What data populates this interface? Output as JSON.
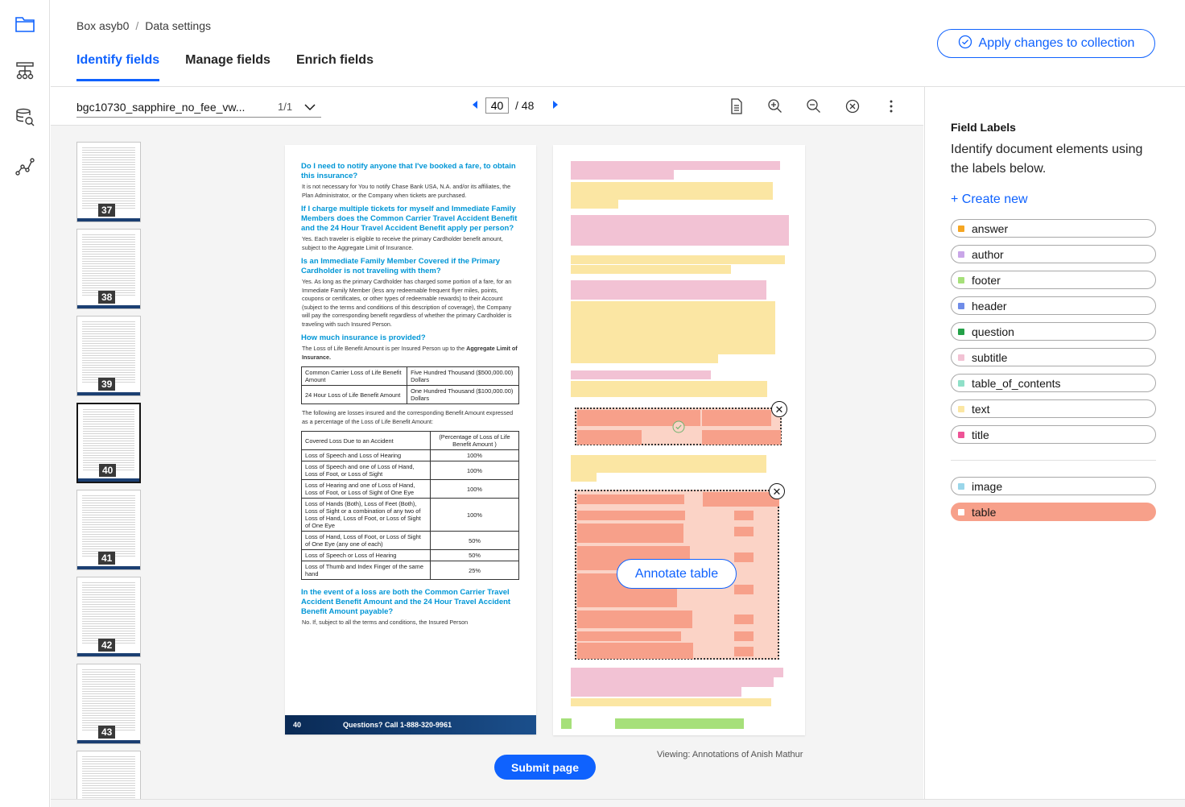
{
  "header": {
    "breadcrumb": [
      "Box asyb0",
      "Data settings"
    ],
    "tabs": [
      {
        "label": "Identify fields",
        "active": true
      },
      {
        "label": "Manage fields",
        "active": false
      },
      {
        "label": "Enrich fields",
        "active": false
      }
    ],
    "apply_label": "Apply changes to collection"
  },
  "toolbar": {
    "file_name": "bgc10730_sapphire_no_fee_vw...",
    "file_count": "1/1",
    "page_value": "40",
    "page_total": "/ 48"
  },
  "thumbnails": [
    "37",
    "38",
    "39",
    "40",
    "41",
    "42",
    "43"
  ],
  "selected_thumbnail": "40",
  "document": {
    "sections": [
      {
        "q": "Do I need to notify anyone that I've booked a fare, to obtain this insurance?",
        "a": "It is not necessary for You to notify Chase Bank USA, N.A. and/or its affiliates, the Plan Administrator, or the Company when tickets are purchased."
      },
      {
        "q": "If I charge multiple tickets for myself and Immediate Family Members does the Common Carrier Travel Accident Benefit and the 24 Hour Travel Accident Benefit apply per person?",
        "a": "Yes. Each traveler is eligible to receive the primary Cardholder benefit amount, subject to the Aggregate Limit of Insurance."
      },
      {
        "q": "Is an Immediate Family Member Covered if the Primary Cardholder is not traveling with them?",
        "a": "Yes. As long as the primary Cardholder has charged some portion of a fare, for an Immediate Family Member (less any redeemable frequent flyer miles, points, coupons or certificates, or other types of redeemable rewards) to their Account (subject to the terms and conditions of this description of coverage), the Company will pay the corresponding benefit regardless of whether the primary Cardholder is traveling with such Insured Person."
      },
      {
        "q": "How much insurance is provided?",
        "a": "The Loss of Life Benefit Amount is per Insured Person up to the",
        "a_bold": "Aggregate Limit of Insurance."
      }
    ],
    "table1": [
      [
        "Common Carrier Loss of Life Benefit Amount",
        "Five Hundred Thousand ($500,000.00) Dollars"
      ],
      [
        "24 Hour Loss of Life Benefit Amount",
        "One Hundred Thousand ($100,000.00) Dollars"
      ]
    ],
    "mid_text": "The following are losses insured and the corresponding Benefit Amount expressed as a percentage of the Loss of Life Benefit Amount:",
    "table2_header": [
      "Covered Loss Due to an Accident",
      "(Percentage of Loss of Life Benefit Amount )"
    ],
    "table2": [
      [
        "Loss of Speech and Loss of Hearing",
        "100%"
      ],
      [
        "Loss of Speech and one of Loss of Hand, Loss of Foot, or Loss of Sight",
        "100%"
      ],
      [
        "Loss of Hearing and one of Loss of Hand, Loss of Foot, or Loss of Sight of One Eye",
        "100%"
      ],
      [
        "Loss of Hands (Both), Loss of Feet (Both), Loss of Sight or a combination of any two of Loss of Hand, Loss of Foot, or Loss of Sight of One Eye",
        "100%"
      ],
      [
        "Loss of Hand, Loss of Foot, or Loss of Sight of One Eye (any one of each)",
        "50%"
      ],
      [
        "Loss of Speech or Loss of Hearing",
        "50%"
      ],
      [
        "Loss of Thumb and Index Finger of the same hand",
        "25%"
      ]
    ],
    "last_q": "In the event of a loss are both the Common Carrier Travel Accident Benefit Amount and the 24 Hour Travel Accident Benefit Amount payable?",
    "last_a": "No. If, subject to all the terms and conditions, the Insured Person",
    "footer_page": "40",
    "footer_text": "Questions? Call 1-888-320-9961"
  },
  "annotation": {
    "annotate_label": "Annotate table",
    "close_symbol": "✕"
  },
  "submit_label": "Submit page",
  "viewing_text": "Viewing: Annotations of Anish Mathur",
  "panel": {
    "title": "Field Labels",
    "description": "Identify document elements using the labels below.",
    "create_new": "+ Create new",
    "labels": [
      {
        "name": "answer",
        "color": "#f5a623"
      },
      {
        "name": "author",
        "color": "#c9a6e8"
      },
      {
        "name": "footer",
        "color": "#a6e07a"
      },
      {
        "name": "header",
        "color": "#6f8ce8"
      },
      {
        "name": "question",
        "color": "#24a148"
      },
      {
        "name": "subtitle",
        "color": "#f2c2d4"
      },
      {
        "name": "table_of_contents",
        "color": "#8fe0c8"
      },
      {
        "name": "text",
        "color": "#fbe6a3"
      },
      {
        "name": "title",
        "color": "#ee5396"
      }
    ],
    "labels2": [
      {
        "name": "image",
        "color": "#9ad6ea"
      },
      {
        "name": "table",
        "color": "#ffffff",
        "active": true
      }
    ]
  }
}
